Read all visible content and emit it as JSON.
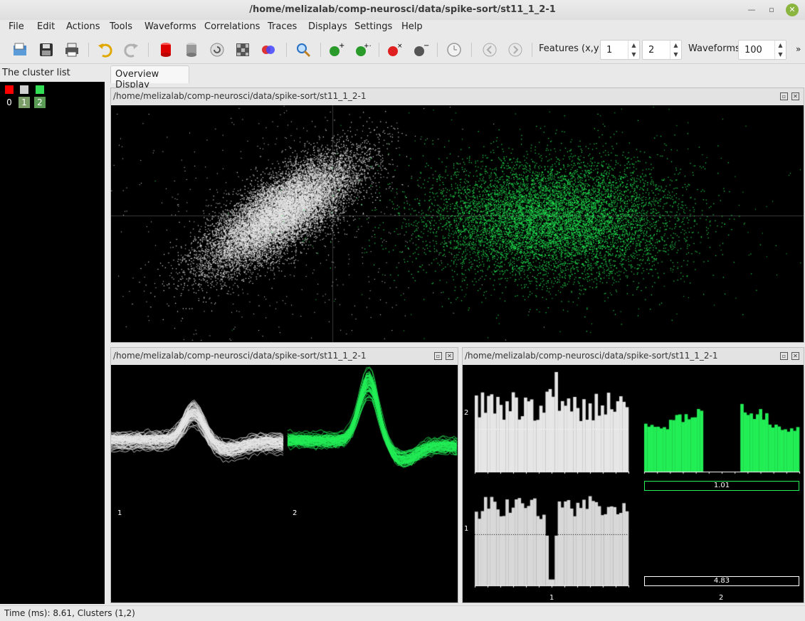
{
  "window": {
    "title": "/home/melizalab/comp-neurosci/data/spike-sort/st11_1_2-1"
  },
  "menu": [
    "File",
    "Edit",
    "Actions",
    "Tools",
    "Waveforms",
    "Correlations",
    "Traces",
    "Displays",
    "Settings",
    "Help"
  ],
  "toolbar": {
    "features_label": "Features (x,y)",
    "feature_x": "1",
    "feature_y": "2",
    "waveforms_label": "Waveforms",
    "waveforms_count": "100"
  },
  "cluster_list": {
    "title": "The cluster list",
    "clusters": [
      {
        "id": "0",
        "color": "#ff0000"
      },
      {
        "id": "1",
        "color": "#d0d0d0"
      },
      {
        "id": "2",
        "color": "#33dd55"
      }
    ]
  },
  "tabs": [
    "Overview Display"
  ],
  "panels": {
    "feature_view_title": "/home/melizalab/comp-neurosci/data/spike-sort/st11_1_2-1",
    "waveform_view_title": "/home/melizalab/comp-neurosci/data/spike-sort/st11_1_2-1",
    "correlogram_view_title": "/home/melizalab/comp-neurosci/data/spike-sort/st11_1_2-1"
  },
  "waveforms": {
    "labels": [
      "1",
      "2"
    ]
  },
  "correlograms": {
    "y_label_top": "2",
    "y_label_bottom": "1",
    "x_label_left": "1",
    "x_label_right": "2",
    "ratio_top": "1.01",
    "ratio_bottom": "4.83"
  },
  "status": {
    "text": "Time (ms): 8.61, Clusters (1,2)"
  },
  "colors": {
    "cluster1": "#e6e6e6",
    "cluster2": "#22ee55",
    "background": "#000000"
  }
}
